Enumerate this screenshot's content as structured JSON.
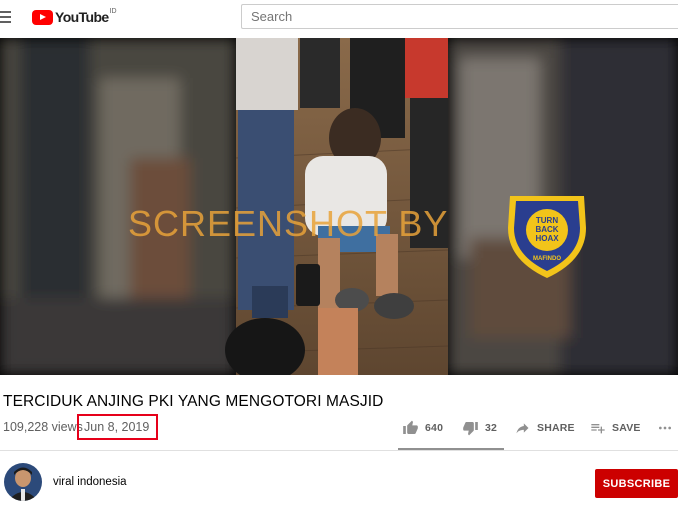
{
  "header": {
    "logo_text": "YouTube",
    "country_code": "ID",
    "search_placeholder": "Search"
  },
  "video": {
    "watermark_text": "SCREENSHOT BY",
    "badge": {
      "center_text_lines": [
        "TURN",
        "BACK",
        "HOAX"
      ],
      "ring_left_text": "MASYARAKAT",
      "ring_top_text": "ANTI FITNAH INDONESIA",
      "ring_bottom_text": "MAFINDO"
    },
    "title": "TERCIDUK ANJING PKI YANG MENGOTORI MASJID",
    "views": "109,228 views",
    "date": "Jun 8, 2019"
  },
  "actions": {
    "like_count": "640",
    "dislike_count": "32",
    "share_label": "SHARE",
    "save_label": "SAVE"
  },
  "channel": {
    "name": "viral indonesia",
    "subscribe_label": "SUBSCRIBE"
  },
  "colors": {
    "brand_red": "#ff0000",
    "subscribe_red": "#cc0000",
    "highlight_box": "#e6001a",
    "watermark_orange": "#e8a23a",
    "badge_blue": "#2a3e8f",
    "badge_yellow": "#f2c41a"
  },
  "icons": {
    "menu": "hamburger-icon",
    "like": "thumb-up-icon",
    "dislike": "thumb-down-icon",
    "share": "share-arrow-icon",
    "save": "playlist-add-icon",
    "more": "more-horizontal-icon"
  }
}
